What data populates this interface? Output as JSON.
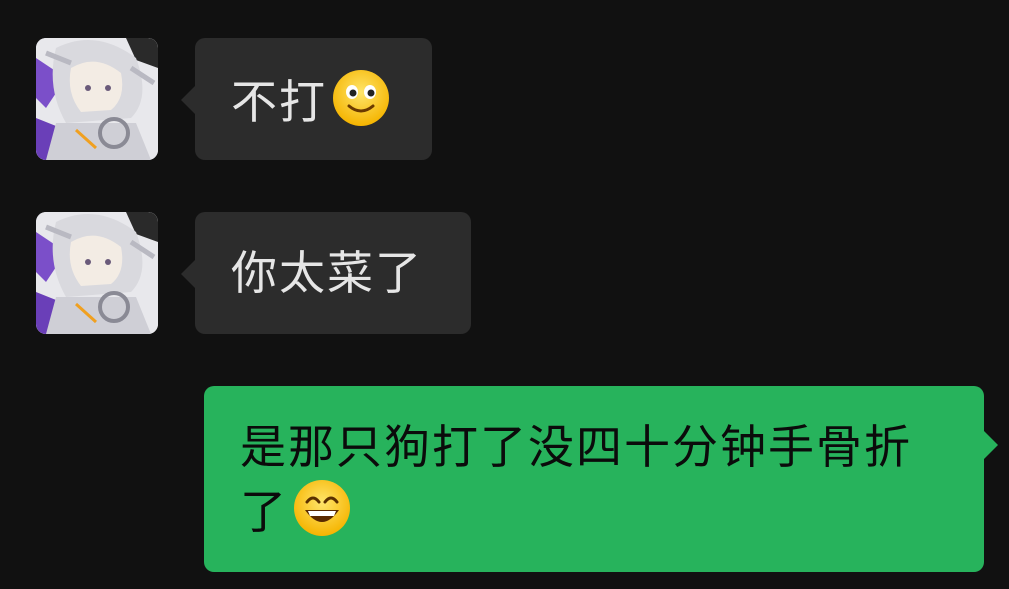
{
  "messages": [
    {
      "direction": "incoming",
      "text": "不打",
      "emoji": "slightly-smiling-face",
      "avatar": "anime-character-avatar"
    },
    {
      "direction": "incoming",
      "text": "你太菜了",
      "avatar": "anime-character-avatar"
    },
    {
      "direction": "outgoing",
      "text_line1": "是那只狗打了没四十分钟手骨折",
      "text_line2": "了",
      "emoji": "grinning-face-with-smiling-eyes"
    }
  ],
  "colors": {
    "background": "#111111",
    "incoming_bubble": "#2c2c2c",
    "outgoing_bubble": "#27b35c",
    "incoming_text": "#e6e6e6",
    "outgoing_text": "#0b0b0b"
  }
}
